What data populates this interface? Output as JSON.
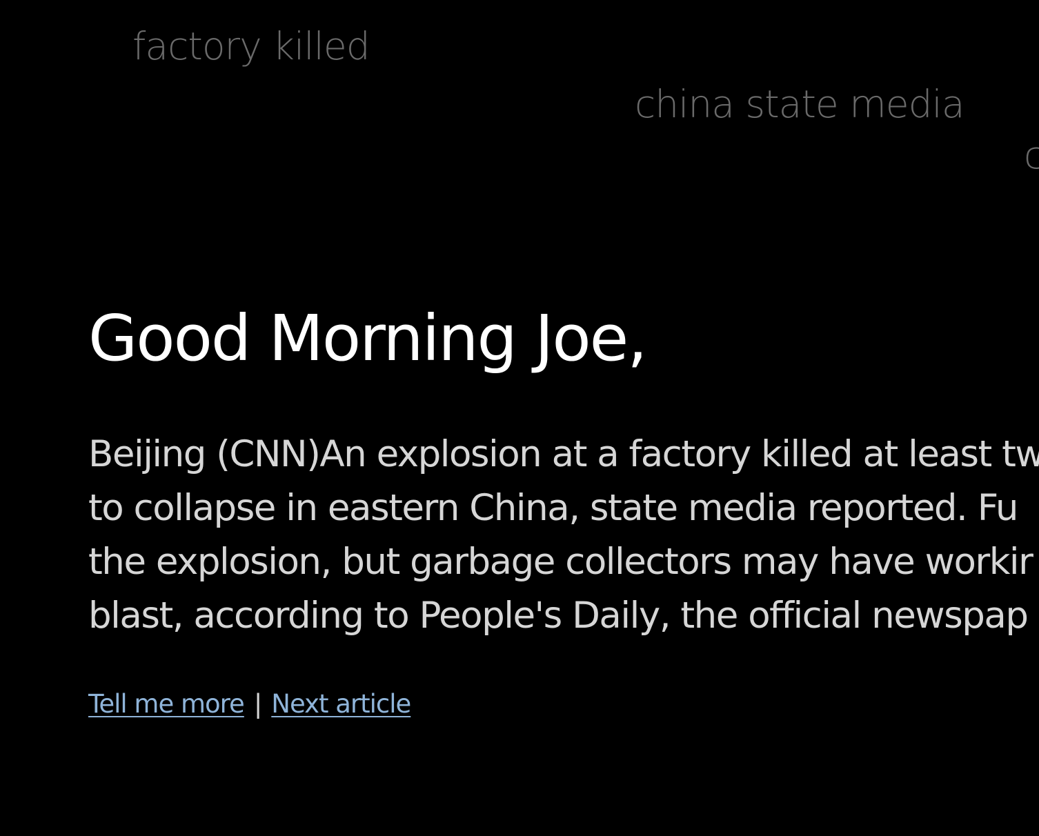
{
  "keywords": [
    {
      "text": "factory killed"
    },
    {
      "text": "china state media"
    },
    {
      "text": "c"
    }
  ],
  "greeting": "Good Morning Joe,",
  "article": {
    "lines": [
      "Beijing (CNN)An explosion at a factory killed at least tw",
      "to collapse in eastern China, state media reported. Fu",
      "the explosion, but garbage collectors may have workir",
      "blast, according to People's Daily, the official newspap"
    ]
  },
  "actions": {
    "tell_me_more": "Tell me more",
    "separator": "|",
    "next_article": "Next article"
  },
  "colors": {
    "background": "#000000",
    "greeting": "#ffffff",
    "body_text": "#d6d6d6",
    "keyword": "#6a6a6a",
    "link": "#8fb4d9"
  }
}
